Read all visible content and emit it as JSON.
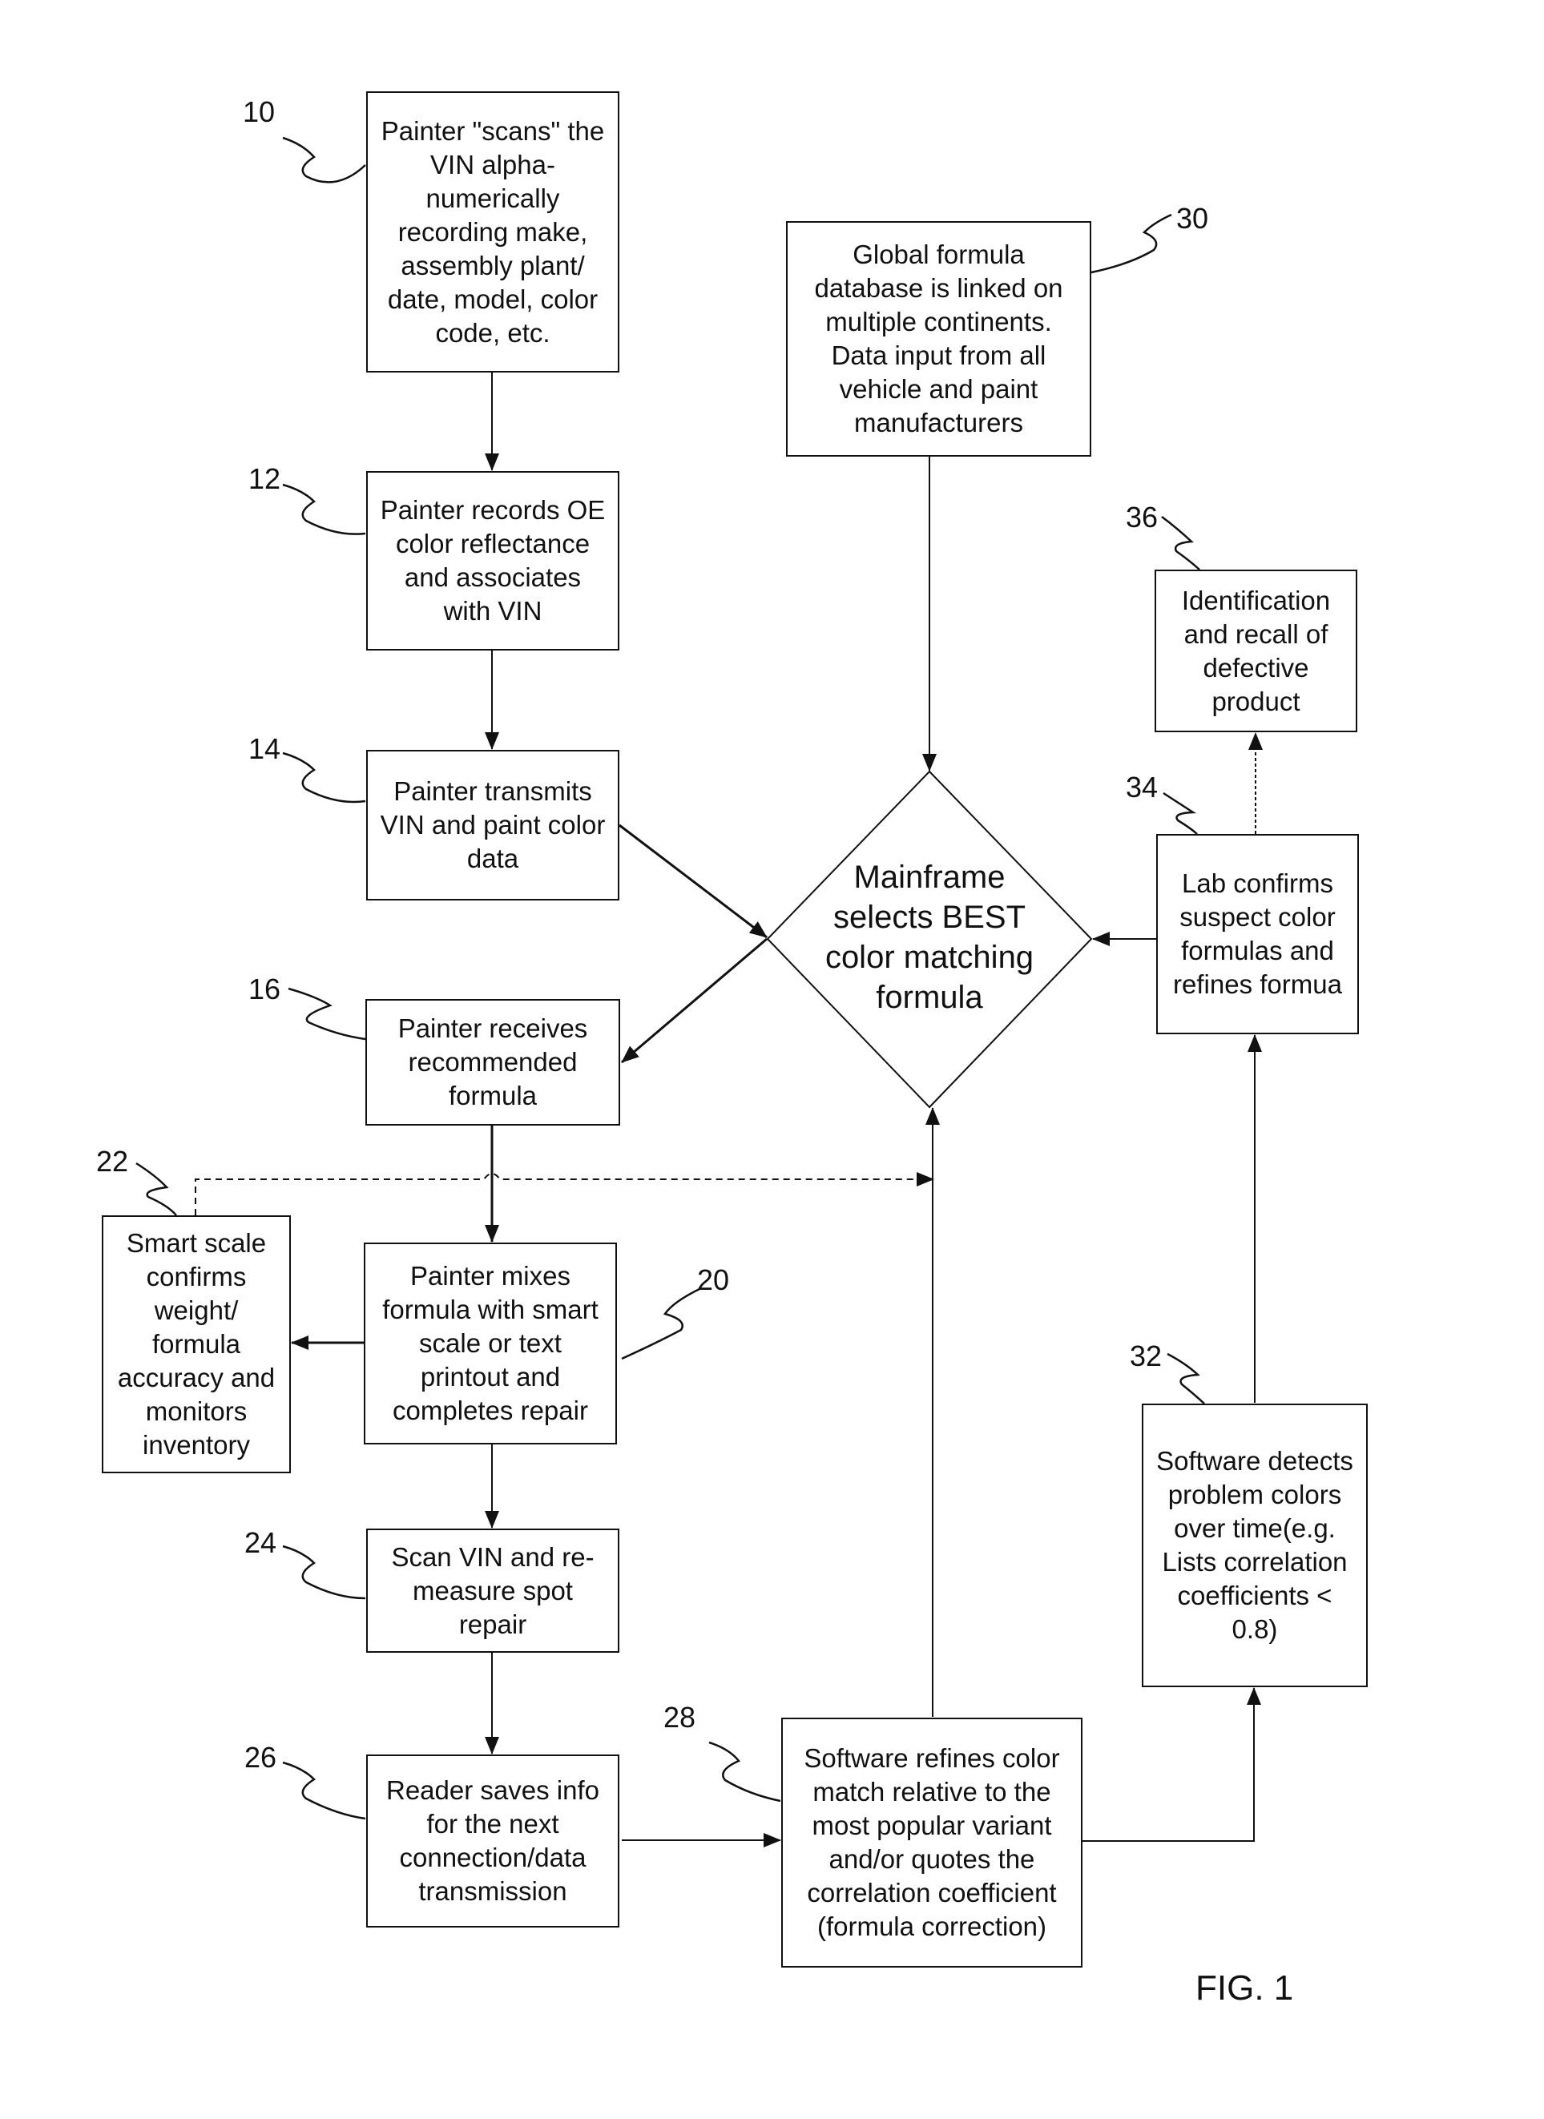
{
  "figure_label": "FIG. 1",
  "nodes": {
    "n10": {
      "ref": "10",
      "text": "Painter \"scans\" the\nVIN alpha-\nnumerically\nrecording make,\nassembly plant/\ndate, model, color\ncode, etc."
    },
    "n12": {
      "ref": "12",
      "text": "Painter records OE\ncolor reflectance\nand associates\nwith VIN"
    },
    "n14": {
      "ref": "14",
      "text": "Painter transmits\nVIN and paint color\ndata"
    },
    "n16": {
      "ref": "16",
      "text": "Painter receives\nrecommended\nformula"
    },
    "n20": {
      "ref": "20",
      "text": "Painter mixes\nformula with smart\nscale or text\nprintout and\ncompletes repair"
    },
    "n22": {
      "ref": "22",
      "text": "Smart scale\nconfirms\nweight/\nformula\naccuracy and\nmonitors\ninventory"
    },
    "n24": {
      "ref": "24",
      "text": "Scan VIN and re-\nmeasure spot\nrepair"
    },
    "n26": {
      "ref": "26",
      "text": "Reader saves info\nfor the next\nconnection/data\ntransmission"
    },
    "n28": {
      "ref": "28",
      "text": "Software refines color\nmatch relative to the\nmost popular variant\nand/or quotes the\ncorrelation coefficient\n(formula correction)"
    },
    "n30": {
      "ref": "30",
      "text": "Global formula\ndatabase is linked on\nmultiple continents.\nData input from all\nvehicle and paint\nmanufacturers"
    },
    "n32": {
      "ref": "32",
      "text": "Software detects\nproblem colors\nover time(e.g.\nLists correlation\ncoefficients <\n0.8)"
    },
    "n34": {
      "ref": "34",
      "text": "Lab confirms\nsuspect color\nformulas and\nrefines formua"
    },
    "n36": {
      "ref": "36",
      "text": "Identification\nand recall of\ndefective\nproduct"
    },
    "mainframe": {
      "text": "Mainframe\nselects BEST\ncolor matching\nformula"
    }
  },
  "edges": [
    {
      "from": "10",
      "to": "12",
      "style": "solid"
    },
    {
      "from": "12",
      "to": "14",
      "style": "solid"
    },
    {
      "from": "14",
      "to": "mainframe",
      "style": "solid"
    },
    {
      "from": "mainframe",
      "to": "16",
      "style": "solid"
    },
    {
      "from": "30",
      "to": "mainframe",
      "style": "solid"
    },
    {
      "from": "16",
      "to": "20",
      "style": "solid"
    },
    {
      "from": "20",
      "to": "22",
      "style": "solid"
    },
    {
      "from": "22",
      "to": "mainframe",
      "style": "dashed"
    },
    {
      "from": "20",
      "to": "24",
      "style": "solid"
    },
    {
      "from": "24",
      "to": "26",
      "style": "solid"
    },
    {
      "from": "26",
      "to": "28",
      "style": "solid"
    },
    {
      "from": "28",
      "to": "mainframe",
      "style": "solid"
    },
    {
      "from": "28",
      "to": "32",
      "style": "solid"
    },
    {
      "from": "32",
      "to": "34",
      "style": "solid"
    },
    {
      "from": "34",
      "to": "mainframe",
      "style": "solid"
    },
    {
      "from": "34",
      "to": "36",
      "style": "solid"
    }
  ]
}
